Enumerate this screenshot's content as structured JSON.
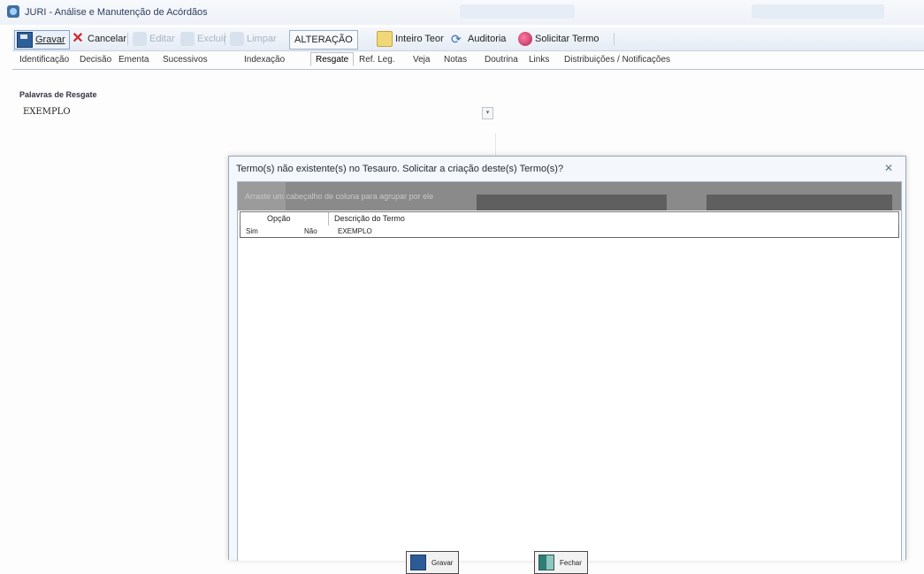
{
  "window": {
    "title": "JURI - Análise e Manutenção de Acórdãos"
  },
  "toolbar": {
    "save": "Gravar",
    "cancel": "Cancelar",
    "edit": "Editar",
    "delete": "Excluir",
    "clear": "Limpar",
    "mode": "ALTERAÇÃO",
    "full_text": "Inteiro Teor",
    "audit": "Auditoria",
    "request_term": "Solicitar Termo"
  },
  "tabs": [
    "Identificação",
    "Decisão",
    "Ementa",
    "Sucessivos",
    "Indexação",
    "Resgate",
    "Ref. Leg.",
    "Veja",
    "Notas",
    "Doutrina",
    "Links",
    "Distribuições / Notificações"
  ],
  "active_tab": "Resgate",
  "main": {
    "keywords_label": "Palavras de Resgate",
    "keyword_value": "EXEMPLO"
  },
  "dialog": {
    "title": "Termo(s) não existente(s) no Tesauro. Solicitar a criação deste(s) Termo(s)?",
    "close_glyph": "✕",
    "hint": "Arraste um cabeçalho de coluna para agrupar por ele",
    "columns": [
      "Opção",
      "Descrição do Termo"
    ],
    "rows": [
      {
        "yes": "Sim",
        "no": "Não",
        "term": "EXEMPLO"
      }
    ],
    "buttons": {
      "save": "Gravar",
      "close": "Fechar"
    }
  },
  "colors": {
    "accent": "#2d5f9a",
    "dialog_header": "#8a8a8a"
  }
}
